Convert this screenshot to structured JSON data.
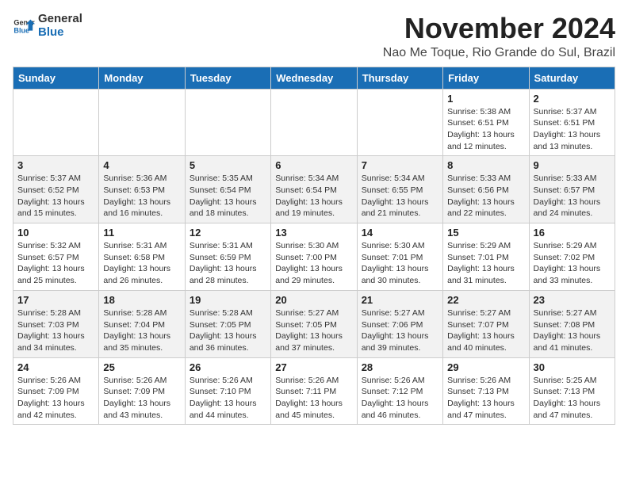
{
  "logo": {
    "text_general": "General",
    "text_blue": "Blue"
  },
  "header": {
    "month_year": "November 2024",
    "location": "Nao Me Toque, Rio Grande do Sul, Brazil"
  },
  "weekdays": [
    "Sunday",
    "Monday",
    "Tuesday",
    "Wednesday",
    "Thursday",
    "Friday",
    "Saturday"
  ],
  "weeks": [
    [
      {
        "day": "",
        "info": ""
      },
      {
        "day": "",
        "info": ""
      },
      {
        "day": "",
        "info": ""
      },
      {
        "day": "",
        "info": ""
      },
      {
        "day": "",
        "info": ""
      },
      {
        "day": "1",
        "info": "Sunrise: 5:38 AM\nSunset: 6:51 PM\nDaylight: 13 hours and 12 minutes."
      },
      {
        "day": "2",
        "info": "Sunrise: 5:37 AM\nSunset: 6:51 PM\nDaylight: 13 hours and 13 minutes."
      }
    ],
    [
      {
        "day": "3",
        "info": "Sunrise: 5:37 AM\nSunset: 6:52 PM\nDaylight: 13 hours and 15 minutes."
      },
      {
        "day": "4",
        "info": "Sunrise: 5:36 AM\nSunset: 6:53 PM\nDaylight: 13 hours and 16 minutes."
      },
      {
        "day": "5",
        "info": "Sunrise: 5:35 AM\nSunset: 6:54 PM\nDaylight: 13 hours and 18 minutes."
      },
      {
        "day": "6",
        "info": "Sunrise: 5:34 AM\nSunset: 6:54 PM\nDaylight: 13 hours and 19 minutes."
      },
      {
        "day": "7",
        "info": "Sunrise: 5:34 AM\nSunset: 6:55 PM\nDaylight: 13 hours and 21 minutes."
      },
      {
        "day": "8",
        "info": "Sunrise: 5:33 AM\nSunset: 6:56 PM\nDaylight: 13 hours and 22 minutes."
      },
      {
        "day": "9",
        "info": "Sunrise: 5:33 AM\nSunset: 6:57 PM\nDaylight: 13 hours and 24 minutes."
      }
    ],
    [
      {
        "day": "10",
        "info": "Sunrise: 5:32 AM\nSunset: 6:57 PM\nDaylight: 13 hours and 25 minutes."
      },
      {
        "day": "11",
        "info": "Sunrise: 5:31 AM\nSunset: 6:58 PM\nDaylight: 13 hours and 26 minutes."
      },
      {
        "day": "12",
        "info": "Sunrise: 5:31 AM\nSunset: 6:59 PM\nDaylight: 13 hours and 28 minutes."
      },
      {
        "day": "13",
        "info": "Sunrise: 5:30 AM\nSunset: 7:00 PM\nDaylight: 13 hours and 29 minutes."
      },
      {
        "day": "14",
        "info": "Sunrise: 5:30 AM\nSunset: 7:01 PM\nDaylight: 13 hours and 30 minutes."
      },
      {
        "day": "15",
        "info": "Sunrise: 5:29 AM\nSunset: 7:01 PM\nDaylight: 13 hours and 31 minutes."
      },
      {
        "day": "16",
        "info": "Sunrise: 5:29 AM\nSunset: 7:02 PM\nDaylight: 13 hours and 33 minutes."
      }
    ],
    [
      {
        "day": "17",
        "info": "Sunrise: 5:28 AM\nSunset: 7:03 PM\nDaylight: 13 hours and 34 minutes."
      },
      {
        "day": "18",
        "info": "Sunrise: 5:28 AM\nSunset: 7:04 PM\nDaylight: 13 hours and 35 minutes."
      },
      {
        "day": "19",
        "info": "Sunrise: 5:28 AM\nSunset: 7:05 PM\nDaylight: 13 hours and 36 minutes."
      },
      {
        "day": "20",
        "info": "Sunrise: 5:27 AM\nSunset: 7:05 PM\nDaylight: 13 hours and 37 minutes."
      },
      {
        "day": "21",
        "info": "Sunrise: 5:27 AM\nSunset: 7:06 PM\nDaylight: 13 hours and 39 minutes."
      },
      {
        "day": "22",
        "info": "Sunrise: 5:27 AM\nSunset: 7:07 PM\nDaylight: 13 hours and 40 minutes."
      },
      {
        "day": "23",
        "info": "Sunrise: 5:27 AM\nSunset: 7:08 PM\nDaylight: 13 hours and 41 minutes."
      }
    ],
    [
      {
        "day": "24",
        "info": "Sunrise: 5:26 AM\nSunset: 7:09 PM\nDaylight: 13 hours and 42 minutes."
      },
      {
        "day": "25",
        "info": "Sunrise: 5:26 AM\nSunset: 7:09 PM\nDaylight: 13 hours and 43 minutes."
      },
      {
        "day": "26",
        "info": "Sunrise: 5:26 AM\nSunset: 7:10 PM\nDaylight: 13 hours and 44 minutes."
      },
      {
        "day": "27",
        "info": "Sunrise: 5:26 AM\nSunset: 7:11 PM\nDaylight: 13 hours and 45 minutes."
      },
      {
        "day": "28",
        "info": "Sunrise: 5:26 AM\nSunset: 7:12 PM\nDaylight: 13 hours and 46 minutes."
      },
      {
        "day": "29",
        "info": "Sunrise: 5:26 AM\nSunset: 7:13 PM\nDaylight: 13 hours and 47 minutes."
      },
      {
        "day": "30",
        "info": "Sunrise: 5:25 AM\nSunset: 7:13 PM\nDaylight: 13 hours and 47 minutes."
      }
    ]
  ]
}
